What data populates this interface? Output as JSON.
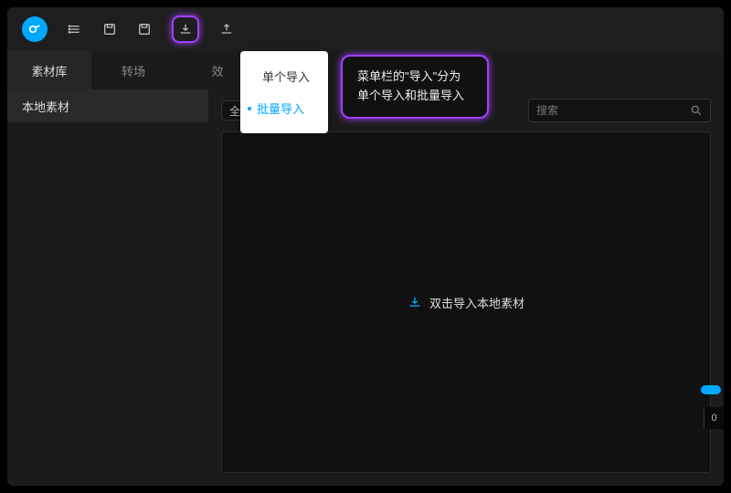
{
  "toolbar": {},
  "dropdown": {
    "item_single": "单个导入",
    "item_batch": "批量导入"
  },
  "tooltip": {
    "line1": "菜单栏的\"导入\"分为",
    "line2": "单个导入和批量导入"
  },
  "tabs": {
    "library": "素材库",
    "transition": "转场",
    "effect_partial": "效"
  },
  "sidebar": {
    "local": "本地素材"
  },
  "filter": {
    "all": "全部"
  },
  "search": {
    "placeholder": "搜索"
  },
  "canvas": {
    "hint": "双击导入本地素材"
  },
  "timeline": {
    "tick": "0"
  }
}
